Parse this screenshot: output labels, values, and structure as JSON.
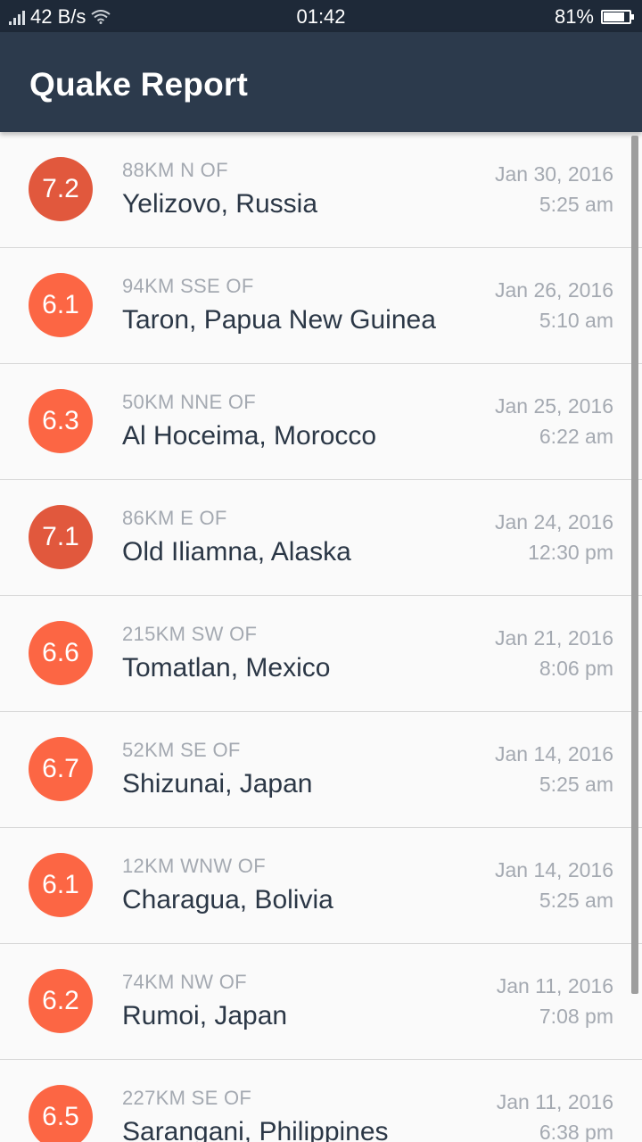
{
  "status_bar": {
    "network_speed": "42 B/s",
    "time": "01:42",
    "battery_percent": "81%",
    "battery_level": 0.81,
    "icons": [
      "signal-icon",
      "wifi-icon",
      "battery-icon"
    ]
  },
  "app_bar": {
    "title": "Quake Report",
    "background": "#2c3a4c"
  },
  "quakes": [
    {
      "magnitude": "7.2",
      "offset": "88KM N OF",
      "location": "Yelizovo, Russia",
      "date": "Jan 30, 2016",
      "time": "5:25 am",
      "color": "#e1583d"
    },
    {
      "magnitude": "6.1",
      "offset": "94KM SSE OF",
      "location": "Taron, Papua New Guinea",
      "date": "Jan 26, 2016",
      "time": "5:10 am",
      "color": "#fc6644"
    },
    {
      "magnitude": "6.3",
      "offset": "50KM NNE OF",
      "location": "Al Hoceima, Morocco",
      "date": "Jan 25, 2016",
      "time": "6:22 am",
      "color": "#fc6644"
    },
    {
      "magnitude": "7.1",
      "offset": "86KM E OF",
      "location": "Old Iliamna, Alaska",
      "date": "Jan 24, 2016",
      "time": "12:30 pm",
      "color": "#e1583d"
    },
    {
      "magnitude": "6.6",
      "offset": "215KM SW OF",
      "location": "Tomatlan, Mexico",
      "date": "Jan 21, 2016",
      "time": "8:06 pm",
      "color": "#fc6644"
    },
    {
      "magnitude": "6.7",
      "offset": "52KM SE OF",
      "location": "Shizunai, Japan",
      "date": "Jan 14, 2016",
      "time": "5:25 am",
      "color": "#fc6644"
    },
    {
      "magnitude": "6.1",
      "offset": "12KM WNW OF",
      "location": "Charagua, Bolivia",
      "date": "Jan 14, 2016",
      "time": "5:25 am",
      "color": "#fc6644"
    },
    {
      "magnitude": "6.2",
      "offset": "74KM NW OF",
      "location": "Rumoi, Japan",
      "date": "Jan 11, 2016",
      "time": "7:08 pm",
      "color": "#fc6644"
    },
    {
      "magnitude": "6.5",
      "offset": "227KM SE OF",
      "location": "Sarangani, Philippines",
      "date": "Jan 11, 2016",
      "time": "6:38 pm",
      "color": "#fc6644"
    }
  ]
}
